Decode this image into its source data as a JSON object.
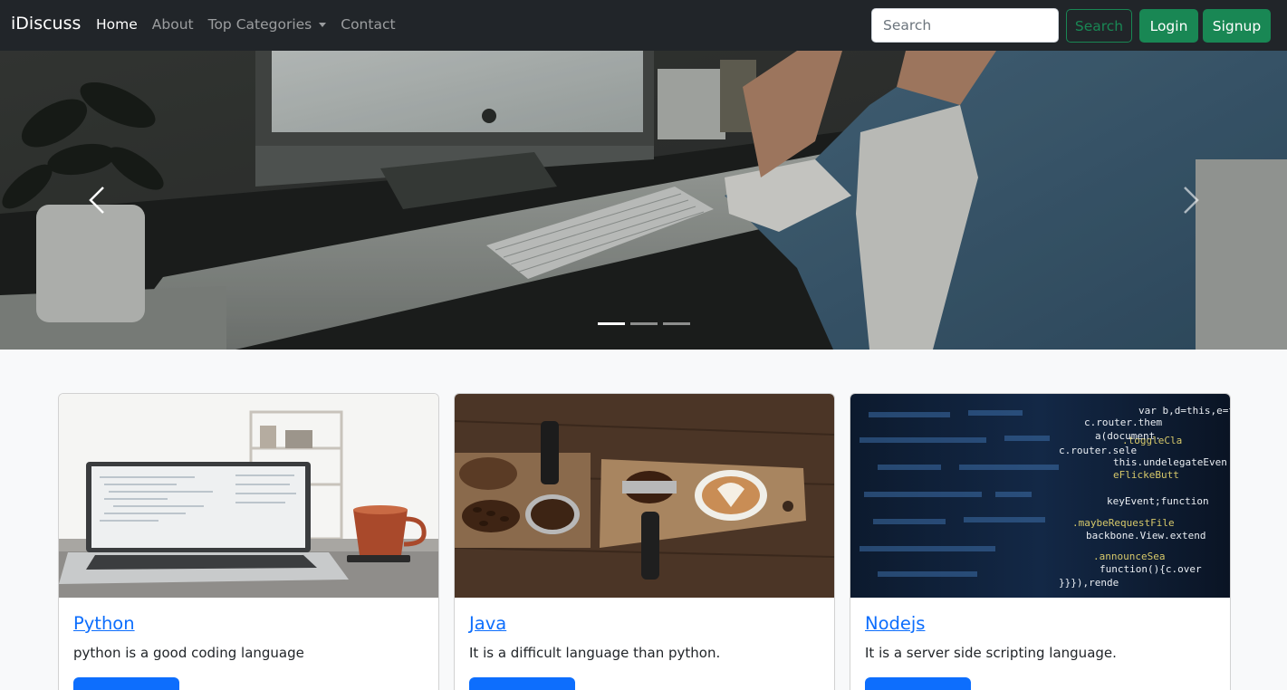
{
  "navbar": {
    "brand": "iDiscuss",
    "links": [
      {
        "label": "Home",
        "active": true
      },
      {
        "label": "About",
        "active": false
      },
      {
        "label": "Top Categories",
        "active": false,
        "dropdown": true
      },
      {
        "label": "Contact",
        "active": false
      }
    ],
    "search_placeholder": "Search",
    "search_button": "Search",
    "login_button": "Login",
    "signup_button": "Signup"
  },
  "carousel": {
    "prev_icon": "chevron-left-icon",
    "next_icon": "chevron-right-icon",
    "slide_count": 3,
    "active_slide": 1
  },
  "cards": [
    {
      "title": "Python",
      "text": "python is a good coding language",
      "image": "laptop-with-coffee-cup"
    },
    {
      "title": "Java",
      "text": "It is a difficult language than python.",
      "image": "coffee-beans-and-latte"
    },
    {
      "title": "Nodejs",
      "text": "It is a server side scripting language.",
      "image": "code-on-screen"
    }
  ],
  "colors": {
    "navbar_bg": "#212529",
    "success": "#198754",
    "primary": "#0d6efd",
    "page_bg": "#f8f9fa"
  }
}
